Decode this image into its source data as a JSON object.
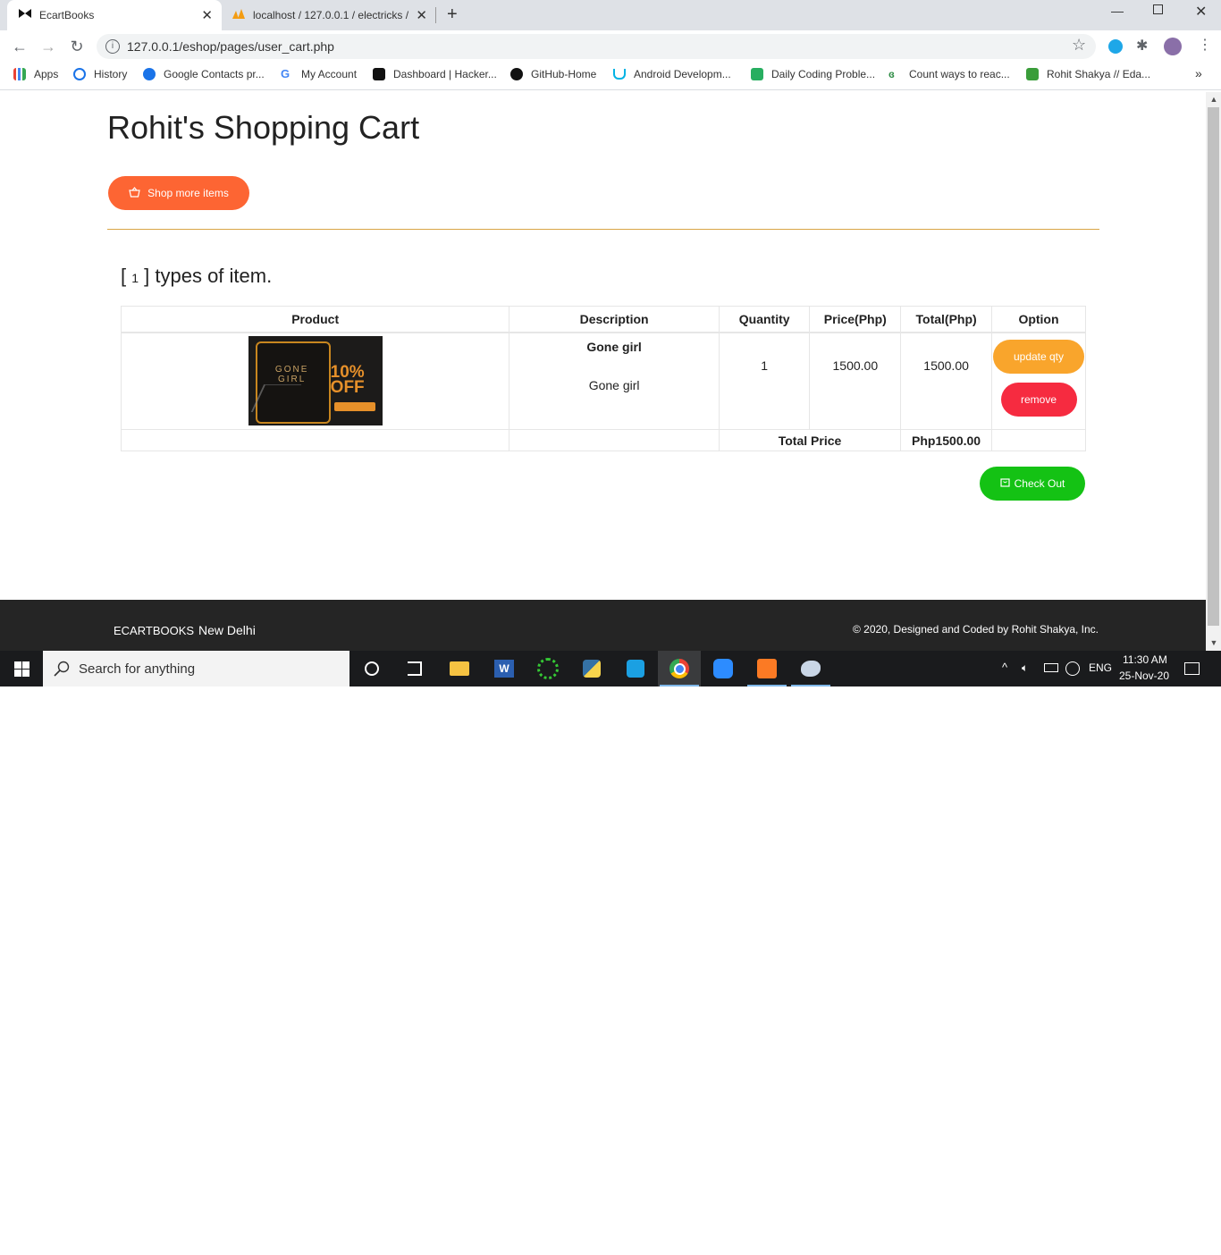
{
  "browser": {
    "tabs": [
      {
        "title": "EcartBooks",
        "active": true
      },
      {
        "title": "localhost / 127.0.0.1 / electricks /",
        "active": false
      }
    ],
    "url": "127.0.0.1/eshop/pages/user_cart.php",
    "bookmarks": [
      {
        "label": "Apps",
        "icon": "apps-grid-icon"
      },
      {
        "label": "History",
        "icon": "history-icon"
      },
      {
        "label": "Google Contacts pr...",
        "icon": "contacts-icon"
      },
      {
        "label": "My Account",
        "icon": "google-icon"
      },
      {
        "label": "Dashboard | Hacker...",
        "icon": "hackerrank-icon"
      },
      {
        "label": "GitHub-Home",
        "icon": "github-icon"
      },
      {
        "label": "Android Developm...",
        "icon": "udacity-icon"
      },
      {
        "label": "Daily Coding Proble...",
        "icon": "daily-coding-icon"
      },
      {
        "label": "Count ways to reac...",
        "icon": "geeksforgeeks-icon"
      },
      {
        "label": "Rohit Shakya // Eda...",
        "icon": "edabit-icon"
      }
    ]
  },
  "page": {
    "title": "Rohit's Shopping Cart",
    "shop_more_label": "Shop more items",
    "item_count_prefix": "[ ",
    "item_count": "1",
    "item_count_suffix": " ] types of item."
  },
  "cart": {
    "headers": [
      "Product",
      "Description",
      "Quantity",
      "Price(Php)",
      "Total(Php)",
      "Option"
    ],
    "rows": [
      {
        "product_image": "Gone Girl book cover - 10% OFF",
        "name": "Gone girl",
        "description": "Gone girl",
        "quantity": "1",
        "price": "1500.00",
        "total": "1500.00",
        "update_label": "update qty",
        "remove_label": "remove"
      }
    ],
    "total_label": "Total Price",
    "total_value": "Php1500.00",
    "checkout_label": "Check Out"
  },
  "footer": {
    "brand": "ECARTBOOKS",
    "city": "New Delhi",
    "copyright": "© 2020, Designed and Coded by Rohit Shakya, Inc."
  },
  "taskbar": {
    "search_placeholder": "Search for anything",
    "language": "ENG",
    "time": "11:30 AM",
    "date": "25-Nov-20"
  },
  "colors": {
    "shop_more": "#fd6533",
    "update_qty": "#f9a52c",
    "remove": "#f62b40",
    "checkout": "#14c214",
    "divider": "#d9a545",
    "footer": "#252525"
  }
}
